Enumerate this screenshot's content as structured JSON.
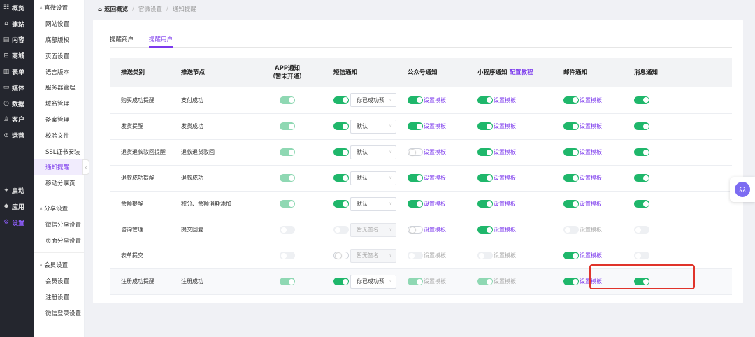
{
  "nav": [
    {
      "label": "概览",
      "icon": "grid-icon",
      "glyph": "☷"
    },
    {
      "label": "建站",
      "icon": "home-icon",
      "glyph": "⌂"
    },
    {
      "label": "内容",
      "icon": "document-icon",
      "glyph": "▤"
    },
    {
      "label": "商城",
      "icon": "shop-icon",
      "glyph": "⊟"
    },
    {
      "label": "表单",
      "icon": "form-icon",
      "glyph": "▥"
    },
    {
      "label": "媒体",
      "icon": "media-icon",
      "glyph": "▭"
    },
    {
      "label": "数据",
      "icon": "chart-icon",
      "glyph": "◷"
    },
    {
      "label": "客户",
      "icon": "user-icon",
      "glyph": "♙"
    },
    {
      "label": "运营",
      "icon": "link-icon",
      "glyph": "⊘"
    }
  ],
  "nav_bottom": [
    {
      "label": "启动",
      "icon": "launch-icon",
      "glyph": "✦"
    },
    {
      "label": "应用",
      "icon": "apps-icon",
      "glyph": "◆"
    },
    {
      "label": "设置",
      "icon": "gear-icon",
      "glyph": "⚙"
    }
  ],
  "sidebar": {
    "groups": [
      {
        "title": "官微设置",
        "items": [
          "网站设置",
          "底部版权",
          "页面设置",
          "语言版本",
          "服务器管理",
          "域名管理",
          "备案管理",
          "校验文件",
          "SSL证书安装",
          "通知提醒",
          "移动分享页"
        ]
      },
      {
        "title": "分享设置",
        "items": [
          "微信分享设置",
          "页面分享设置"
        ]
      },
      {
        "title": "会员设置",
        "items": [
          "会员设置",
          "注册设置",
          "微信登录设置"
        ]
      }
    ],
    "active_item": "通知提醒"
  },
  "breadcrumb": {
    "home": "返回概览",
    "sep": "/",
    "level1": "官微设置",
    "level2": "通知提醒"
  },
  "tabs": [
    "提醒商户",
    "提醒用户"
  ],
  "active_tab": "提醒用户",
  "table": {
    "headers": {
      "type": "推送类别",
      "node": "推送节点",
      "app": "APP通知",
      "app_note": "（暂未开通）",
      "sms": "短信通知",
      "wechat": "公众号通知",
      "mini": "小程序通知",
      "mini_link": "配置教程",
      "email": "邮件通知",
      "msg": "消息通知"
    },
    "template_label": "设置模板",
    "rows": [
      {
        "type": "购买成功提醒",
        "node": "支付成功",
        "app": "dis-on",
        "sms": "on",
        "sms_sel": "你已成功预",
        "sms_sel_state": "normal",
        "wechat": "on",
        "wechat_tpl": "on",
        "mini": "on",
        "mini_tpl": "on",
        "email": "on",
        "email_tpl": "on",
        "msg": "on"
      },
      {
        "type": "发货提醒",
        "node": "发货成功",
        "app": "dis-on",
        "sms": "on",
        "sms_sel": "默认",
        "sms_sel_state": "normal",
        "wechat": "on",
        "wechat_tpl": "on",
        "mini": "on",
        "mini_tpl": "on",
        "email": "on",
        "email_tpl": "on",
        "msg": "on"
      },
      {
        "type": "退货退款驳回提醒",
        "node": "退款退货驳回",
        "app": "dis-on",
        "sms": "on",
        "sms_sel": "默认",
        "sms_sel_state": "normal",
        "wechat": "off",
        "wechat_tpl": "on",
        "mini": "on",
        "mini_tpl": "on",
        "email": "on",
        "email_tpl": "on",
        "msg": "on"
      },
      {
        "type": "退款成功提醒",
        "node": "退款成功",
        "app": "dis-on",
        "sms": "on",
        "sms_sel": "默认",
        "sms_sel_state": "normal",
        "wechat": "on",
        "wechat_tpl": "on",
        "mini": "on",
        "mini_tpl": "on",
        "email": "on",
        "email_tpl": "on",
        "msg": "on"
      },
      {
        "type": "余额提醒",
        "node": "积分、余额消耗添加",
        "app": "dis-on",
        "sms": "on",
        "sms_sel": "默认",
        "sms_sel_state": "normal",
        "wechat": "on",
        "wechat_tpl": "on",
        "mini": "on",
        "mini_tpl": "on",
        "email": "on",
        "email_tpl": "on",
        "msg": "on"
      },
      {
        "type": "咨询管理",
        "node": "提交回复",
        "app": "dis-off",
        "sms": "dis-off",
        "sms_sel": "暂无签名",
        "sms_sel_state": "dis",
        "wechat": "off",
        "wechat_tpl": "on",
        "mini": "on",
        "mini_tpl": "on",
        "email": "dis-off",
        "email_tpl": "dis",
        "msg": "dis-off"
      },
      {
        "type": "表单提交",
        "node": "",
        "app": "dis-off",
        "sms": "off",
        "sms_sel": "暂无签名",
        "sms_sel_state": "dis",
        "wechat": "dis-off",
        "wechat_tpl": "dis",
        "mini": "dis-off",
        "mini_tpl": "dis",
        "email": "on",
        "email_tpl": "on",
        "msg": "dis-off"
      },
      {
        "type": "注册成功提醒",
        "node": "注册成功",
        "app": "dis-on",
        "sms": "on",
        "sms_sel": "你已成功预",
        "sms_sel_state": "normal",
        "wechat": "dis-on",
        "wechat_tpl": "dis",
        "mini": "dis-on",
        "mini_tpl": "dis",
        "email": "on",
        "email_tpl": "on",
        "msg": "on"
      }
    ]
  },
  "colors": {
    "accent": "#7c3aed",
    "toggle_on": "#1fb76b",
    "highlight": "#e0342b",
    "nav_bg": "#24262e"
  },
  "help_icon": "customer-service-icon"
}
